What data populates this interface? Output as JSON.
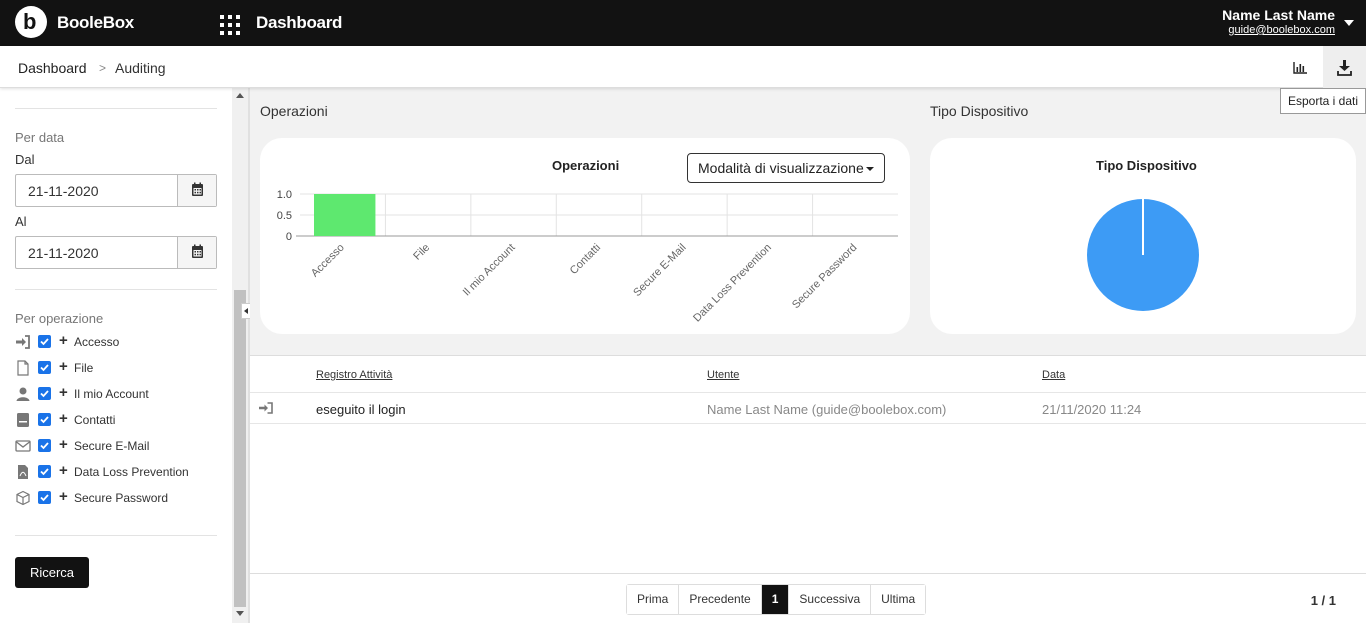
{
  "app": {
    "brand": "BooleBox",
    "nav_title": "Dashboard"
  },
  "user": {
    "name": "Name Last Name",
    "email": "guide@boolebox.com"
  },
  "breadcrumb": {
    "items": [
      "Dashboard",
      "Auditing"
    ],
    "separator": ">"
  },
  "toolbar": {
    "export_tooltip": "Esporta i dati"
  },
  "filters": {
    "by_date_label": "Per data",
    "from_label": "Dal",
    "from_value": "21-11-2020",
    "to_label": "Al",
    "to_value": "21-11-2020",
    "by_operation_label": "Per operazione",
    "operations": [
      {
        "label": "Accesso",
        "icon": "sign-in-icon",
        "checked": true
      },
      {
        "label": "File",
        "icon": "file-icon",
        "checked": true
      },
      {
        "label": "Il mio Account",
        "icon": "user-icon",
        "checked": true
      },
      {
        "label": "Contatti",
        "icon": "address-book-icon",
        "checked": true
      },
      {
        "label": "Secure E-Mail",
        "icon": "envelope-icon",
        "checked": true
      },
      {
        "label": "Data Loss Prevention",
        "icon": "file-pdf-icon",
        "checked": true
      },
      {
        "label": "Secure Password",
        "icon": "cube-icon",
        "checked": true
      }
    ],
    "search_label": "Ricerca"
  },
  "sections": {
    "operations_title": "Operazioni",
    "device_title": "Tipo Dispositivo"
  },
  "ops_chart": {
    "title": "Operazioni",
    "mode_label": "Modalità di visualizzazione"
  },
  "device_chart": {
    "title": "Tipo Dispositivo"
  },
  "chart_data": [
    {
      "type": "bar",
      "title": "Operazioni",
      "categories": [
        "Accesso",
        "File",
        "Il mio Account",
        "Contatti",
        "Secure E-Mail",
        "Data Loss Prevention",
        "Secure Password"
      ],
      "values": [
        1,
        0,
        0,
        0,
        0,
        0,
        0
      ],
      "ylim": [
        0,
        1.0
      ],
      "yticks": [
        "1.0",
        "0.5",
        "0"
      ],
      "color": "#5ee86f",
      "grid": true
    },
    {
      "type": "pie",
      "title": "Tipo Dispositivo",
      "values": [
        1
      ],
      "colors": [
        "#3d9bf5"
      ]
    }
  ],
  "table": {
    "headers": [
      "Registro Attività",
      "Utente",
      "Data"
    ],
    "rows": [
      {
        "icon": "sign-in-icon",
        "activity": "eseguito il login",
        "user": "Name Last Name (guide@boolebox.com)",
        "date": "21/11/2020 11:24"
      }
    ]
  },
  "pagination": {
    "first": "Prima",
    "prev": "Precedente",
    "current": "1",
    "next": "Successiva",
    "last": "Ultima",
    "count": "1 / 1"
  },
  "colors": {
    "topbar": "#121212",
    "accent_check": "#1a73e8",
    "bar": "#5ee86f",
    "pie": "#3d9bf5"
  }
}
